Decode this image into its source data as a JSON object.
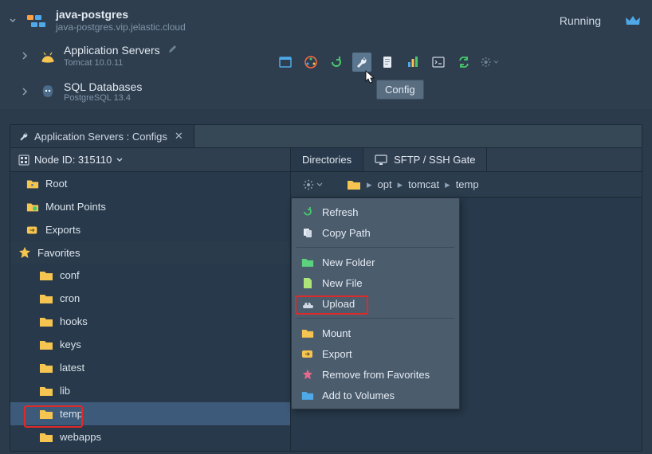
{
  "env": {
    "name": "java-postgres",
    "host": "java-postgres.vip.jelastic.cloud",
    "status": "Running"
  },
  "layers": [
    {
      "title": "Application Servers",
      "sub": "Tomcat 10.0.11"
    },
    {
      "title": "SQL Databases",
      "sub": "PostgreSQL 13.4"
    }
  ],
  "toolbar_tooltip": "Config",
  "config_tab": "Application Servers : Configs",
  "tree": {
    "node_id_label": "Node ID: 315110",
    "roots": [
      {
        "name": "Root"
      },
      {
        "name": "Mount Points"
      },
      {
        "name": "Exports"
      }
    ],
    "fav_header": "Favorites",
    "favorites": [
      "conf",
      "cron",
      "hooks",
      "keys",
      "latest",
      "lib",
      "temp",
      "webapps"
    ],
    "selected": "temp"
  },
  "right": {
    "tab_dirs": "Directories",
    "tab_sftp": "SFTP / SSH Gate",
    "breadcrumb": [
      "opt",
      "tomcat",
      "temp"
    ]
  },
  "ctx": {
    "refresh": "Refresh",
    "copypath": "Copy Path",
    "newfolder": "New Folder",
    "newfile": "New File",
    "upload": "Upload",
    "mount": "Mount",
    "export": "Export",
    "removefav": "Remove from Favorites",
    "addvol": "Add to Volumes"
  }
}
